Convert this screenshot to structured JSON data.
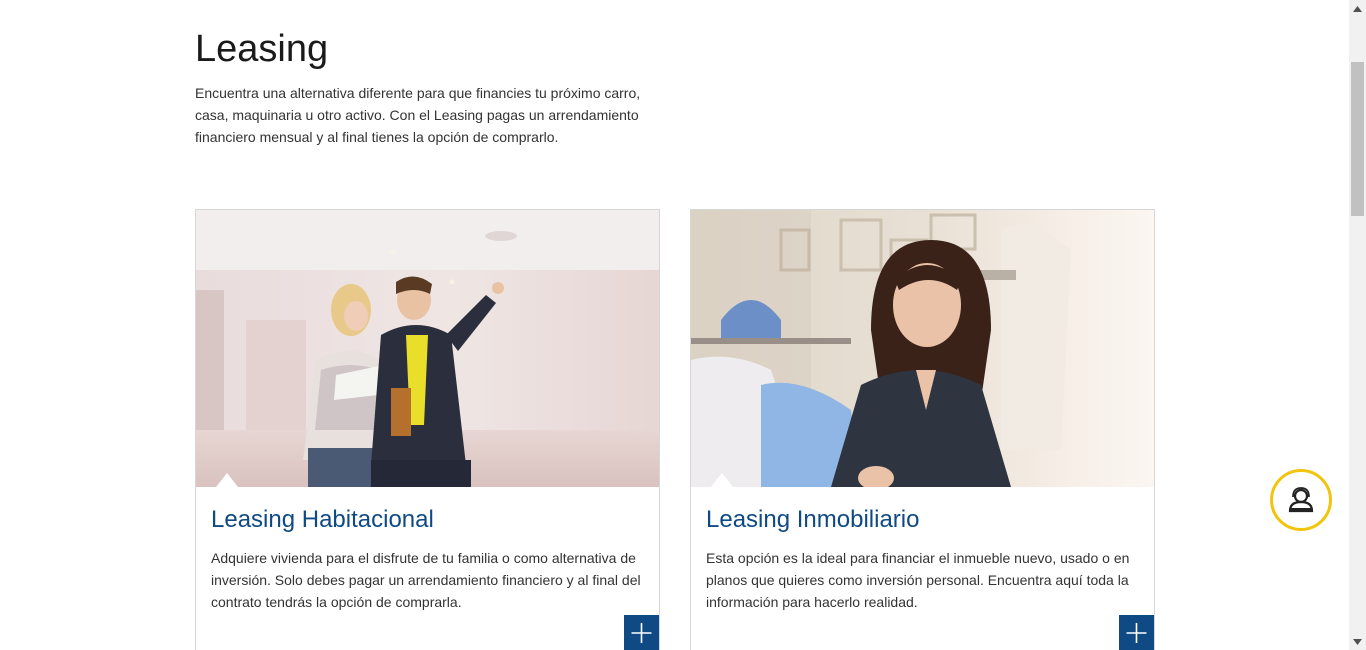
{
  "header": {
    "title": "Leasing",
    "intro": "Encuentra una alternativa diferente para que financies tu próximo carro, casa, maquinaria u otro activo. Con el Leasing pagas un arrendamiento financiero mensual y al final tienes la opción de comprarlo."
  },
  "cards": [
    {
      "title": "Leasing Habitacional",
      "description": "Adquiere vivienda para el disfrute de tu familia o como alternativa de inversión. Solo debes pagar un arrendamiento financiero y al final del contrato tendrás la opción de comprarla."
    },
    {
      "title": "Leasing Inmobiliario",
      "description": "Esta opción es la ideal para financiar el inmueble nuevo, usado o en planos que quieres como inversión personal. Encuentra aquí toda la información para hacerlo realidad."
    }
  ],
  "icons": {
    "assistant": "assistant-icon",
    "plus": "plus-icon"
  },
  "colors": {
    "accent": "#0f4a85",
    "assistant_ring": "#f1c40f"
  }
}
